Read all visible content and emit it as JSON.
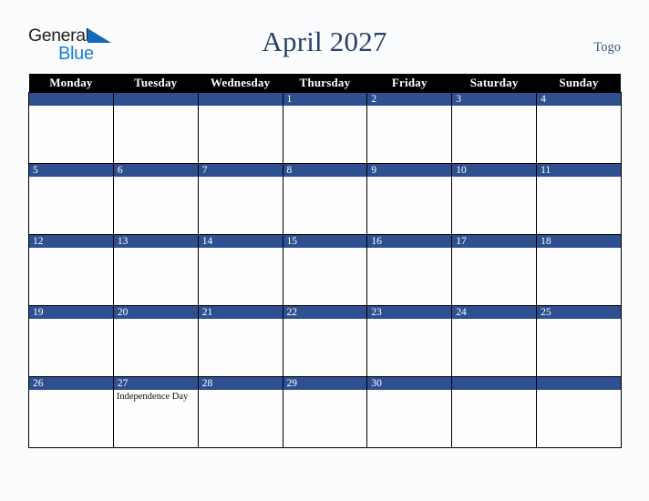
{
  "brand": {
    "name_part1": "General",
    "name_part2": "Blue",
    "triangle_icon": "triangle-icon",
    "color_dark": "#231f20",
    "color_blue": "#1c7fd0"
  },
  "header": {
    "title": "April 2027",
    "country": "Togo",
    "title_color": "#27406b"
  },
  "calendar": {
    "month": "April",
    "year": "2027",
    "weekday_headers": [
      "Monday",
      "Tuesday",
      "Wednesday",
      "Thursday",
      "Friday",
      "Saturday",
      "Sunday"
    ],
    "header_bg": "#000000",
    "header_text_color": "#ffffff",
    "date_bar_bg": "#2e5090",
    "date_text_color": "#ffffff",
    "cell_bg": "#fdfdfd",
    "grid_line_color": "#000000",
    "weeks": [
      [
        {
          "day": "",
          "event": ""
        },
        {
          "day": "",
          "event": ""
        },
        {
          "day": "",
          "event": ""
        },
        {
          "day": "1",
          "event": ""
        },
        {
          "day": "2",
          "event": ""
        },
        {
          "day": "3",
          "event": ""
        },
        {
          "day": "4",
          "event": ""
        }
      ],
      [
        {
          "day": "5",
          "event": ""
        },
        {
          "day": "6",
          "event": ""
        },
        {
          "day": "7",
          "event": ""
        },
        {
          "day": "8",
          "event": ""
        },
        {
          "day": "9",
          "event": ""
        },
        {
          "day": "10",
          "event": ""
        },
        {
          "day": "11",
          "event": ""
        }
      ],
      [
        {
          "day": "12",
          "event": ""
        },
        {
          "day": "13",
          "event": ""
        },
        {
          "day": "14",
          "event": ""
        },
        {
          "day": "15",
          "event": ""
        },
        {
          "day": "16",
          "event": ""
        },
        {
          "day": "17",
          "event": ""
        },
        {
          "day": "18",
          "event": ""
        }
      ],
      [
        {
          "day": "19",
          "event": ""
        },
        {
          "day": "20",
          "event": ""
        },
        {
          "day": "21",
          "event": ""
        },
        {
          "day": "22",
          "event": ""
        },
        {
          "day": "23",
          "event": ""
        },
        {
          "day": "24",
          "event": ""
        },
        {
          "day": "25",
          "event": ""
        }
      ],
      [
        {
          "day": "26",
          "event": ""
        },
        {
          "day": "27",
          "event": "Independence Day"
        },
        {
          "day": "28",
          "event": ""
        },
        {
          "day": "29",
          "event": ""
        },
        {
          "day": "30",
          "event": ""
        },
        {
          "day": "",
          "event": ""
        },
        {
          "day": "",
          "event": ""
        }
      ]
    ]
  }
}
